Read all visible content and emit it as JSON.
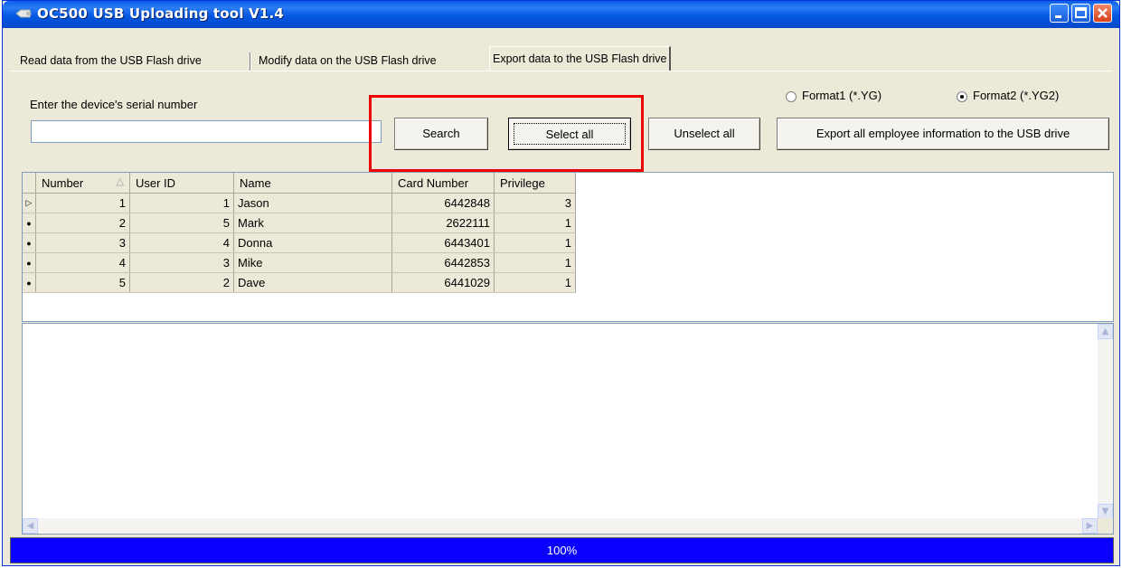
{
  "window": {
    "title": "OC500 USB Uploading tool V1.4",
    "icon": "usb-drive-icon",
    "controls": [
      "minimize-icon",
      "maximize-icon",
      "close-icon"
    ]
  },
  "tabs": [
    {
      "label": "Read data from the USB Flash drive",
      "active": false
    },
    {
      "label": "Modify data on the USB Flash drive",
      "active": false
    },
    {
      "label": "Export data to the USB Flash drive",
      "active": true
    }
  ],
  "export_panel": {
    "serial_label": "Enter the device's serial number",
    "serial_value": "",
    "buttons": {
      "search": "Search",
      "select_all": "Select all",
      "unselect_all": "Unselect all",
      "export_all": "Export all employee information to the USB drive"
    },
    "formats": [
      {
        "label": "Format1 (*.YG)",
        "selected": false
      },
      {
        "label": "Format2 (*.YG2)",
        "selected": true
      }
    ]
  },
  "grid": {
    "columns": [
      "Number",
      "User ID",
      "Name",
      "Card Number",
      "Privilege"
    ],
    "sort_column": "Number",
    "rows": [
      {
        "number": "1",
        "user_id": "1",
        "name": "Jason",
        "card": "6442848",
        "privilege": "3",
        "current": true
      },
      {
        "number": "2",
        "user_id": "5",
        "name": "Mark",
        "card": "2622111",
        "privilege": "1",
        "current": false
      },
      {
        "number": "3",
        "user_id": "4",
        "name": "Donna",
        "card": "6443401",
        "privilege": "1",
        "current": false
      },
      {
        "number": "4",
        "user_id": "3",
        "name": "Mike",
        "card": "6442853",
        "privilege": "1",
        "current": false
      },
      {
        "number": "5",
        "user_id": "2",
        "name": "Dave",
        "card": "6441029",
        "privilege": "1",
        "current": false
      }
    ]
  },
  "log_text": "",
  "progress": {
    "value": 1.0,
    "label": "100%"
  },
  "colors": {
    "titlebar": "#0558e2",
    "progress": "#0a00ff",
    "highlight": "#ee0000"
  }
}
